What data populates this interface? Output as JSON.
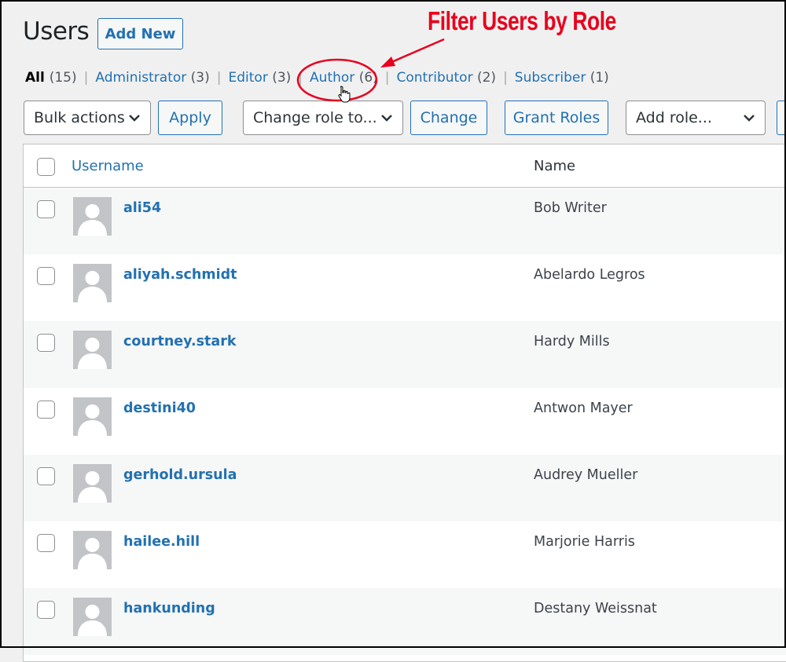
{
  "header": {
    "title": "Users",
    "add_new_label": "Add New"
  },
  "role_filters": [
    {
      "label": "All",
      "count": "(15)",
      "current": true
    },
    {
      "label": "Administrator",
      "count": "(3)"
    },
    {
      "label": "Editor",
      "count": "(3)"
    },
    {
      "label": "Author",
      "count": "(6)"
    },
    {
      "label": "Contributor",
      "count": "(2)"
    },
    {
      "label": "Subscriber",
      "count": "(1)"
    }
  ],
  "toolbar": {
    "bulk_actions": "Bulk actions",
    "apply_label": "Apply",
    "change_role": "Change role to...",
    "change_label": "Change",
    "grant_roles_label": "Grant Roles",
    "add_role": "Add role..."
  },
  "table": {
    "columns": {
      "username": "Username",
      "name": "Name"
    },
    "rows": [
      {
        "username": "ali54",
        "name": "Bob Writer"
      },
      {
        "username": "aliyah.schmidt",
        "name": "Abelardo Legros"
      },
      {
        "username": "courtney.stark",
        "name": "Hardy Mills"
      },
      {
        "username": "destini40",
        "name": "Antwon Mayer"
      },
      {
        "username": "gerhold.ursula",
        "name": "Audrey Mueller"
      },
      {
        "username": "hailee.hill",
        "name": "Marjorie Harris"
      },
      {
        "username": "hankunding",
        "name": "Destany Weissnat"
      }
    ]
  },
  "annotation": {
    "text": "Filter Users by Role",
    "color": "#e8001c"
  },
  "colors": {
    "link": "#2271b1",
    "background": "#f0f0f1"
  }
}
